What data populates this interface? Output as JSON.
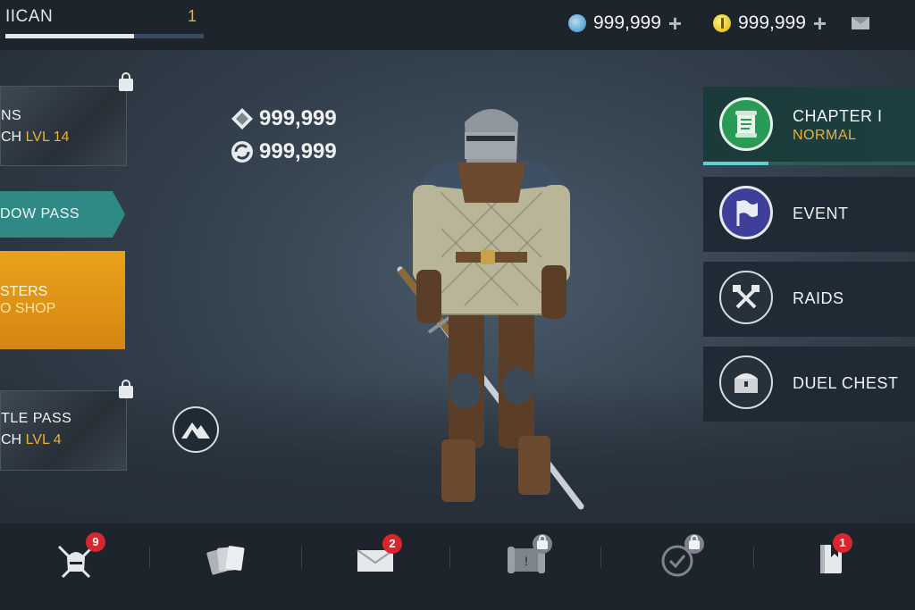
{
  "player": {
    "name": "IICAN",
    "level": "1",
    "xp_progress": 0.65
  },
  "currencies": [
    {
      "icon": "gem-icon",
      "value": "999,999"
    },
    {
      "icon": "coin-icon",
      "value": "999,999"
    }
  ],
  "center_currencies": [
    {
      "icon": "diamond-icon",
      "value": "999,999"
    },
    {
      "icon": "swirl-icon",
      "value": "999,999"
    }
  ],
  "left_panels": {
    "top_tile": {
      "line1": "NS",
      "line2_prefix": "CH",
      "line2_level": "LVL 14"
    },
    "shadow_pass": {
      "label": "DOW PASS"
    },
    "offers": {
      "line1": "STERS",
      "line2": "O SHOP"
    },
    "battle_pass": {
      "line1": "TLE PASS",
      "line2_prefix": "CH",
      "line2_level": "LVL 4"
    }
  },
  "right_menu": {
    "chapter": {
      "title": "CHAPTER I",
      "subtitle": "NORMAL",
      "progress": 0.31
    },
    "event": {
      "title": "EVENT"
    },
    "raids": {
      "title": "RAIDS"
    },
    "duel_chest": {
      "title": "DUEL CHEST"
    }
  },
  "bottom_nav": [
    {
      "name": "fight-nav",
      "icon": "crossed-swords-helmet-icon",
      "badge": "9"
    },
    {
      "name": "cards-nav",
      "icon": "cards-icon",
      "badge": ""
    },
    {
      "name": "mail-nav",
      "icon": "envelope-icon",
      "badge": "2"
    },
    {
      "name": "map-nav",
      "icon": "scroll-map-icon",
      "badge": "",
      "locked": true
    },
    {
      "name": "tasks-nav",
      "icon": "checkmark-icon",
      "badge": "",
      "locked": true
    },
    {
      "name": "journal-nav",
      "icon": "book-icon",
      "badge": "1"
    }
  ],
  "colors": {
    "accent_gold": "#e7b13a",
    "accent_teal": "#2f8a86",
    "badge_red": "#d9262e"
  }
}
